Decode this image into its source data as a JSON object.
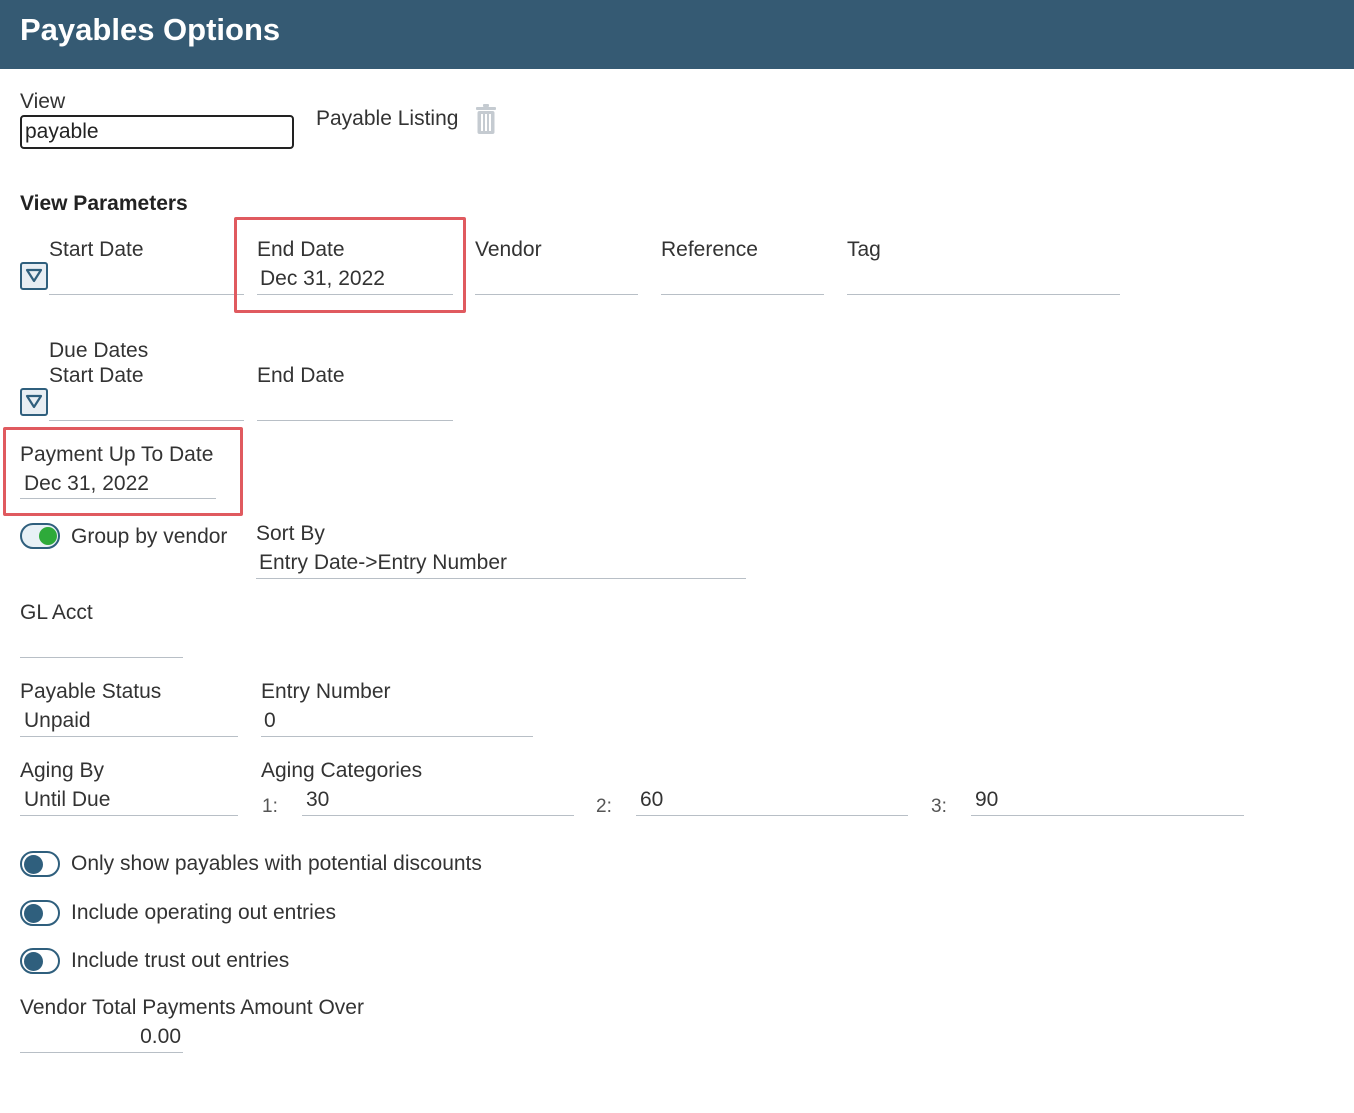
{
  "header": {
    "title": "Payables Options"
  },
  "view": {
    "label": "View",
    "input_value": "payable",
    "listing_label": "Payable Listing",
    "delete_icon": "trash-icon"
  },
  "view_parameters": {
    "heading": "View Parameters",
    "start_date_label": "Start Date",
    "start_date_value": "",
    "end_date_label": "End Date",
    "end_date_value": "Dec 31, 2022",
    "vendor_label": "Vendor",
    "reference_label": "Reference",
    "tag_label": "Tag"
  },
  "due_dates": {
    "label_line1": "Due Dates",
    "start_date_label": "Start Date",
    "end_date_label": "End Date"
  },
  "payment_up_to": {
    "label": "Payment Up To Date",
    "value": "Dec 31, 2022"
  },
  "group_by_vendor": {
    "label": "Group by vendor",
    "on": true
  },
  "sort_by": {
    "label": "Sort By",
    "value": "Entry Date->Entry Number"
  },
  "gl_acct": {
    "label": "GL Acct",
    "value": ""
  },
  "payable_status": {
    "label": "Payable Status",
    "value": "Unpaid"
  },
  "entry_number": {
    "label": "Entry Number",
    "value": "0"
  },
  "aging_by": {
    "label": "Aging By",
    "value": "Until Due"
  },
  "aging_categories": {
    "label": "Aging Categories",
    "items": [
      {
        "num": "1:",
        "value": "30"
      },
      {
        "num": "2:",
        "value": "60"
      },
      {
        "num": "3:",
        "value": "90"
      }
    ]
  },
  "toggles": [
    {
      "label": "Only show payables with potential discounts",
      "on": false
    },
    {
      "label": "Include operating out entries",
      "on": false
    },
    {
      "label": "Include trust out entries",
      "on": false
    }
  ],
  "vendor_total": {
    "label": "Vendor Total Payments Amount Over",
    "value": "0.00"
  },
  "colors": {
    "header_bg": "#355a73",
    "highlight": "#e05a5f",
    "toggle_on": "#2eaa3a",
    "accent": "#2f5f7d"
  }
}
